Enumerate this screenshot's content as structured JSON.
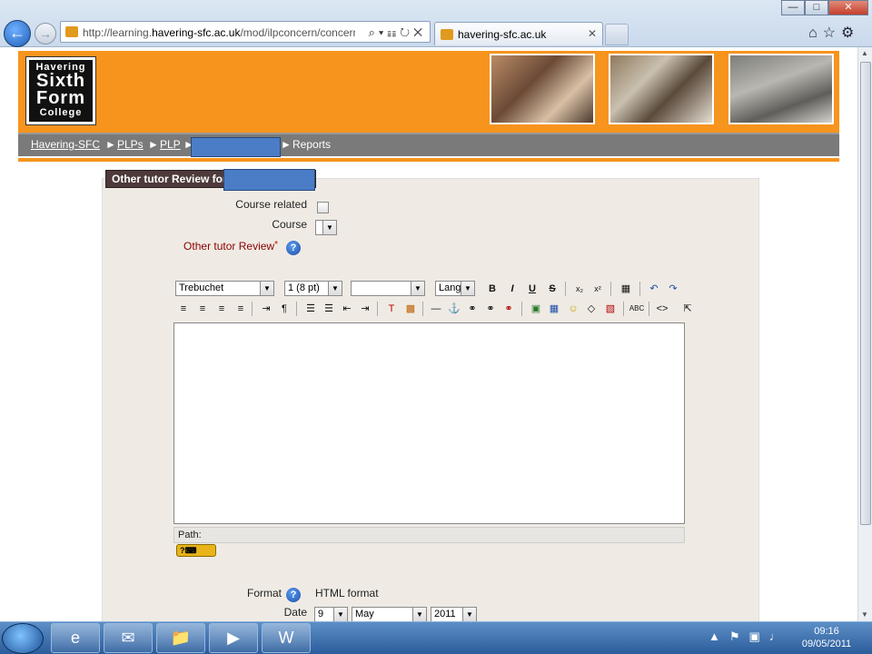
{
  "browser": {
    "address_url_prefix": "http://learning.",
    "address_url_host": "havering-sfc.ac.uk",
    "address_url_path": "/mod/ilpconcern/concerns",
    "tab_title": "havering-sfc.ac.uk"
  },
  "site": {
    "logo_line1": "Havering",
    "logo_line2": "Sixth",
    "logo_line3": "Form",
    "logo_line4": "College"
  },
  "breadcrumb": {
    "items": [
      "Havering-SFC",
      "PLPs",
      "PLP"
    ],
    "separator": "►",
    "last": "Reports"
  },
  "form": {
    "header": "Other tutor Review for",
    "course_related_label": "Course related",
    "course_label": "Course",
    "review_label": "Other tutor Review",
    "required_mark": "*",
    "format_label": "Format",
    "format_value": "HTML format",
    "date_label": "Date",
    "date_day": "9",
    "date_month": "May",
    "date_year": "2011",
    "path_label": "Path:"
  },
  "editor_toolbar": {
    "font": "Trebuchet",
    "size": "1 (8 pt)",
    "style": "",
    "lang": "Lang"
  },
  "taskbar": {
    "time": "09:16",
    "date": "09/05/2011"
  }
}
